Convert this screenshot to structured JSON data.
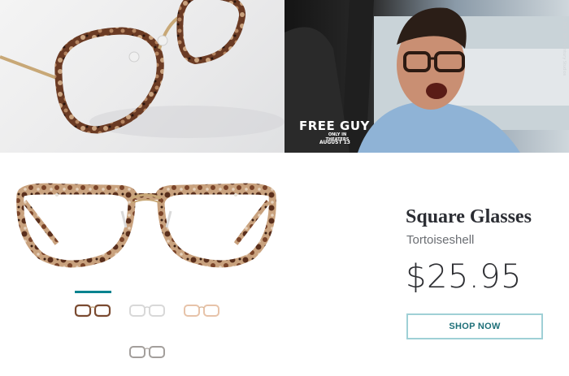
{
  "banner": {
    "movie_title": "FREE GUY",
    "movie_subtitle": "ONLY IN THEATERS",
    "movie_release": "AUGUST 13",
    "copyright": "©2021 20th Century Studios"
  },
  "product": {
    "name": "Square Glasses",
    "color": "Tortoiseshell",
    "price": "$25.95",
    "cta": "SHOP NOW",
    "selected_variant": 0,
    "variants": [
      "tortoiseshell",
      "clear",
      "peach",
      "gray"
    ]
  },
  "colors": {
    "accent": "#00838f",
    "button_border": "#9fd0d6",
    "tortoise_dark": "#4a2a1c",
    "tortoise_light": "#c9a27e"
  }
}
